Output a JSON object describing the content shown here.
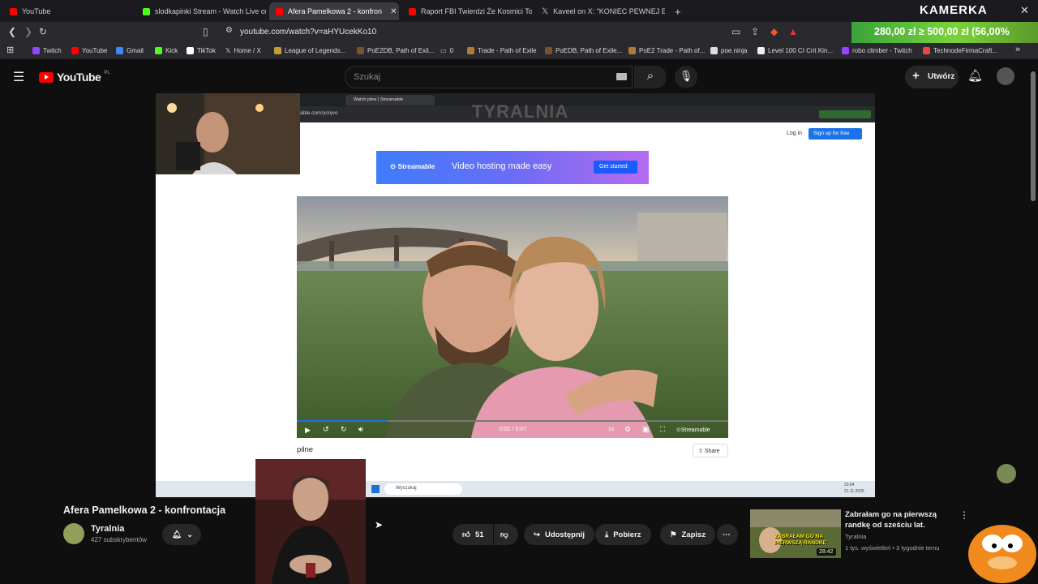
{
  "browser": {
    "tabs": [
      {
        "label": "YouTube",
        "color": "#ff0000"
      },
      {
        "label": "slodkapinki Stream - Watch Live on K",
        "color": "#53fc18"
      },
      {
        "label": "Afera Pamelkowa 2 - konfron",
        "color": "#ff0000"
      },
      {
        "label": "Raport FBI Twierdzi Że Kosmici To Ist",
        "color": "#ff0000"
      },
      {
        "label": "Kaveel on X: \"KONIEC PEWNEJ ERY. J",
        "color": "#ffffff"
      }
    ],
    "new_tab": "+",
    "url": "youtube.com/watch?v=aHYUcekKo10",
    "bookmarks": [
      "Twitch",
      "YouTube",
      "Gmail",
      "Kick",
      "TikTok",
      "Home / X",
      "League of Legends...",
      "PoE2DB, Path of Exil...",
      "0",
      "Trade - Path of Exile",
      "PoEDB, Path of Exile...",
      "PoE2 Trade - Path of...",
      "poe.ninja",
      "Level 100 CI Crit Kin...",
      "robo climber - Twitch",
      "TechnodeFirmaCraft..."
    ],
    "more_bookmarks": "»"
  },
  "overlay": {
    "brand": "KAMERKA",
    "donation": "280,00 zł  ≥  500,00 zł  (56,00%"
  },
  "youtube": {
    "logo": "YouTube",
    "country": "PL",
    "search_placeholder": "Szukaj",
    "create_label": "Utwórz",
    "video_title": "Afera Pamelkowa 2 - konfrontacja",
    "channel_name": "Tyralnia",
    "subscribers": "427 subskrybentów",
    "likes": "51",
    "share_label": "Udostępnij",
    "download_label": "Pobierz",
    "save_label": "Zapisz",
    "suggested": {
      "title": "Zabrałam go na pierwszą randkę od sześciu lat.",
      "channel": "Tyralnia",
      "meta": "1 tys. wyświetleń • 3 tygodnie temu",
      "duration": "28:42",
      "thumb_text": "ZABRAŁAM GO NA PIERWSZĄ RANDKĘ"
    }
  },
  "inner_page": {
    "tab": "Watch pilne | Streamable",
    "url": "able.com/ycnjvo",
    "watermark": "TYRALNIA",
    "login": "Log in",
    "signup": "Sign up for free",
    "banner_brand": "Streamable",
    "banner_text": "Video hosting made easy",
    "banner_cta": "Get started",
    "time": "0:01 / 0:07",
    "speed": "1x",
    "player_brand": "Streamable",
    "video_title": "pilne",
    "share": "Share",
    "taskbar_search": "Wyszukaj",
    "clock_time": "23:04",
    "clock_date": "21.11.2025",
    "progress_pct": 21
  }
}
